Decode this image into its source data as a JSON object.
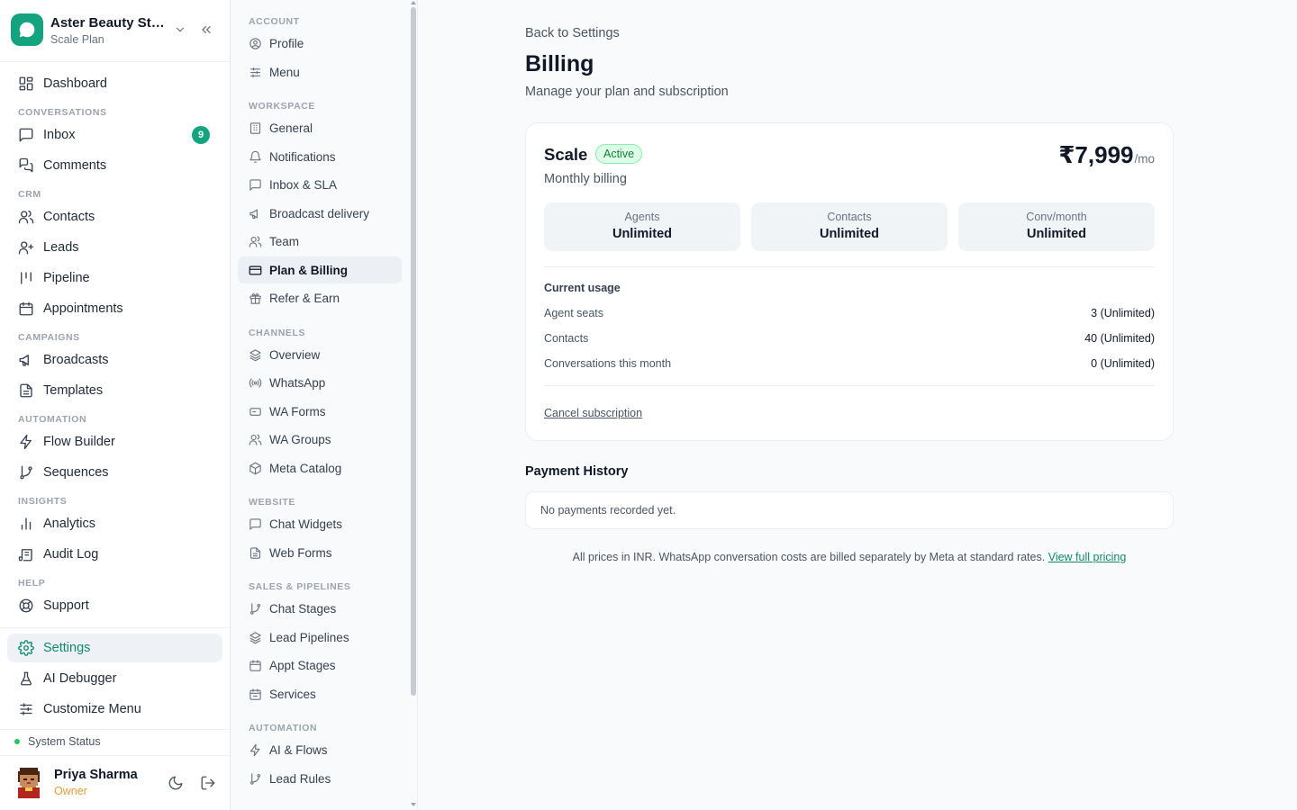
{
  "workspace": {
    "name": "Aster Beauty Stu...",
    "plan": "Scale Plan"
  },
  "sidebar": {
    "items": [
      {
        "label": "Dashboard"
      },
      {
        "group": "CONVERSATIONS"
      },
      {
        "label": "Inbox",
        "badge": "9"
      },
      {
        "label": "Comments"
      },
      {
        "group": "CRM"
      },
      {
        "label": "Contacts"
      },
      {
        "label": "Leads"
      },
      {
        "label": "Pipeline"
      },
      {
        "label": "Appointments"
      },
      {
        "group": "CAMPAIGNS"
      },
      {
        "label": "Broadcasts"
      },
      {
        "label": "Templates"
      },
      {
        "group": "AUTOMATION"
      },
      {
        "label": "Flow Builder"
      },
      {
        "label": "Sequences"
      },
      {
        "group": "INSIGHTS"
      },
      {
        "label": "Analytics"
      },
      {
        "label": "Audit Log"
      },
      {
        "group": "HELP"
      },
      {
        "label": "Support"
      }
    ],
    "bottom": [
      {
        "label": "Settings",
        "active": true
      },
      {
        "label": "AI Debugger"
      },
      {
        "label": "Customize Menu"
      }
    ],
    "system_status": "System Status",
    "user": {
      "name": "Priya Sharma",
      "role": "Owner"
    }
  },
  "settings_nav": {
    "groups": [
      {
        "title": "ACCOUNT",
        "items": [
          "Profile",
          "Menu"
        ]
      },
      {
        "title": "WORKSPACE",
        "items": [
          "General",
          "Notifications",
          "Inbox & SLA",
          "Broadcast delivery",
          "Team",
          "Plan & Billing",
          "Refer & Earn"
        ]
      },
      {
        "title": "CHANNELS",
        "items": [
          "Overview",
          "WhatsApp",
          "WA Forms",
          "WA Groups",
          "Meta Catalog"
        ]
      },
      {
        "title": "WEBSITE",
        "items": [
          "Chat Widgets",
          "Web Forms"
        ]
      },
      {
        "title": "SALES & PIPELINES",
        "items": [
          "Chat Stages",
          "Lead Pipelines",
          "Appt Stages",
          "Services"
        ]
      },
      {
        "title": "AUTOMATION",
        "items": [
          "AI & Flows",
          "Lead Rules"
        ]
      }
    ],
    "active": "Plan & Billing"
  },
  "main": {
    "back": "Back to Settings",
    "title": "Billing",
    "subtitle": "Manage your plan and subscription",
    "plan": {
      "name": "Scale",
      "status": "Active",
      "billing": "Monthly billing",
      "price": "₹7,999",
      "period": "/mo",
      "stats": [
        {
          "label": "Agents",
          "value": "Unlimited"
        },
        {
          "label": "Contacts",
          "value": "Unlimited"
        },
        {
          "label": "Conv/month",
          "value": "Unlimited"
        }
      ],
      "usage_title": "Current usage",
      "usage": [
        {
          "label": "Agent seats",
          "value": "3 (Unlimited)"
        },
        {
          "label": "Contacts",
          "value": "40 (Unlimited)"
        },
        {
          "label": "Conversations this month",
          "value": "0 (Unlimited)"
        }
      ],
      "cancel": "Cancel subscription"
    },
    "payment_history": {
      "title": "Payment History",
      "empty": "No payments recorded yet."
    },
    "footnote": "All prices in INR. WhatsApp conversation costs are billed separately by Meta at standard rates.",
    "footnote_link": "View full pricing"
  },
  "colors": {
    "brand": "#14a37f",
    "active_text": "#0f8a6a",
    "owner": "#e59e3b"
  }
}
